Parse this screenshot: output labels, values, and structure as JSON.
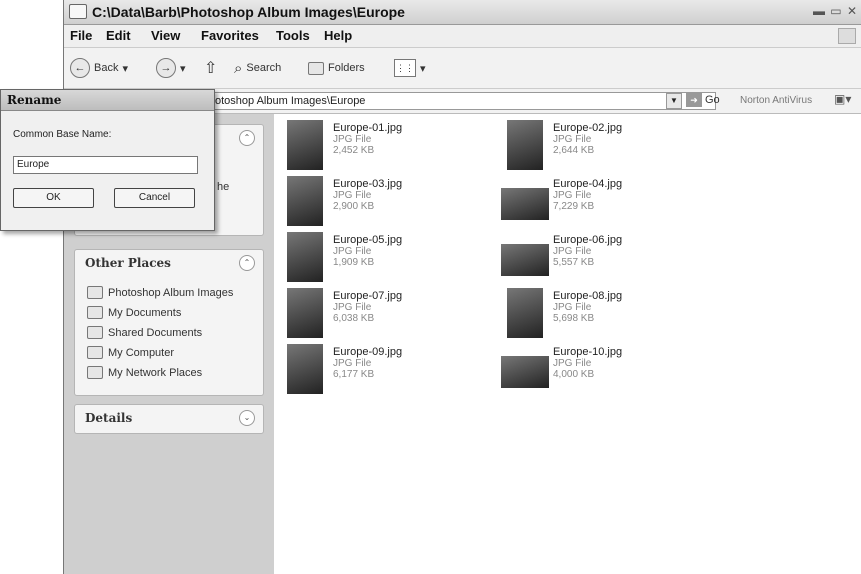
{
  "window": {
    "title": "C:\\Data\\Barb\\Photoshop Album Images\\Europe",
    "controls": "▬ ▭ ✕"
  },
  "menu": [
    "File",
    "Edit",
    "View",
    "Favorites",
    "Tools",
    "Help"
  ],
  "toolbar": {
    "back_label": "Back",
    "search_label": "Search",
    "folders_label": "Folders"
  },
  "address": {
    "path": "otoshop Album Images\\Europe",
    "go_label": "Go",
    "norton_label": "Norton AntiVirus"
  },
  "left_pane": {
    "other_places_header": "Other Places",
    "places": [
      "Photoshop Album Images",
      "My Documents",
      "Shared Documents",
      "My Computer",
      "My Network Places"
    ],
    "details_header": "Details",
    "truncated_text": "he"
  },
  "files": [
    {
      "name": "Europe-01.jpg",
      "type": "JPG File",
      "size": "2,452 KB"
    },
    {
      "name": "Europe-02.jpg",
      "type": "JPG File",
      "size": "2,644 KB"
    },
    {
      "name": "Europe-03.jpg",
      "type": "JPG File",
      "size": "2,900 KB"
    },
    {
      "name": "Europe-04.jpg",
      "type": "JPG File",
      "size": "7,229 KB"
    },
    {
      "name": "Europe-05.jpg",
      "type": "JPG File",
      "size": "1,909 KB"
    },
    {
      "name": "Europe-06.jpg",
      "type": "JPG File",
      "size": "5,557 KB"
    },
    {
      "name": "Europe-07.jpg",
      "type": "JPG File",
      "size": "6,038 KB"
    },
    {
      "name": "Europe-08.jpg",
      "type": "JPG File",
      "size": "5,698 KB"
    },
    {
      "name": "Europe-09.jpg",
      "type": "JPG File",
      "size": "6,177 KB"
    },
    {
      "name": "Europe-10.jpg",
      "type": "JPG File",
      "size": "4,000 KB"
    }
  ],
  "dialog": {
    "title": "Rename",
    "label": "Common Base Name:",
    "value": "Europe",
    "ok_label": "OK",
    "cancel_label": "Cancel"
  }
}
